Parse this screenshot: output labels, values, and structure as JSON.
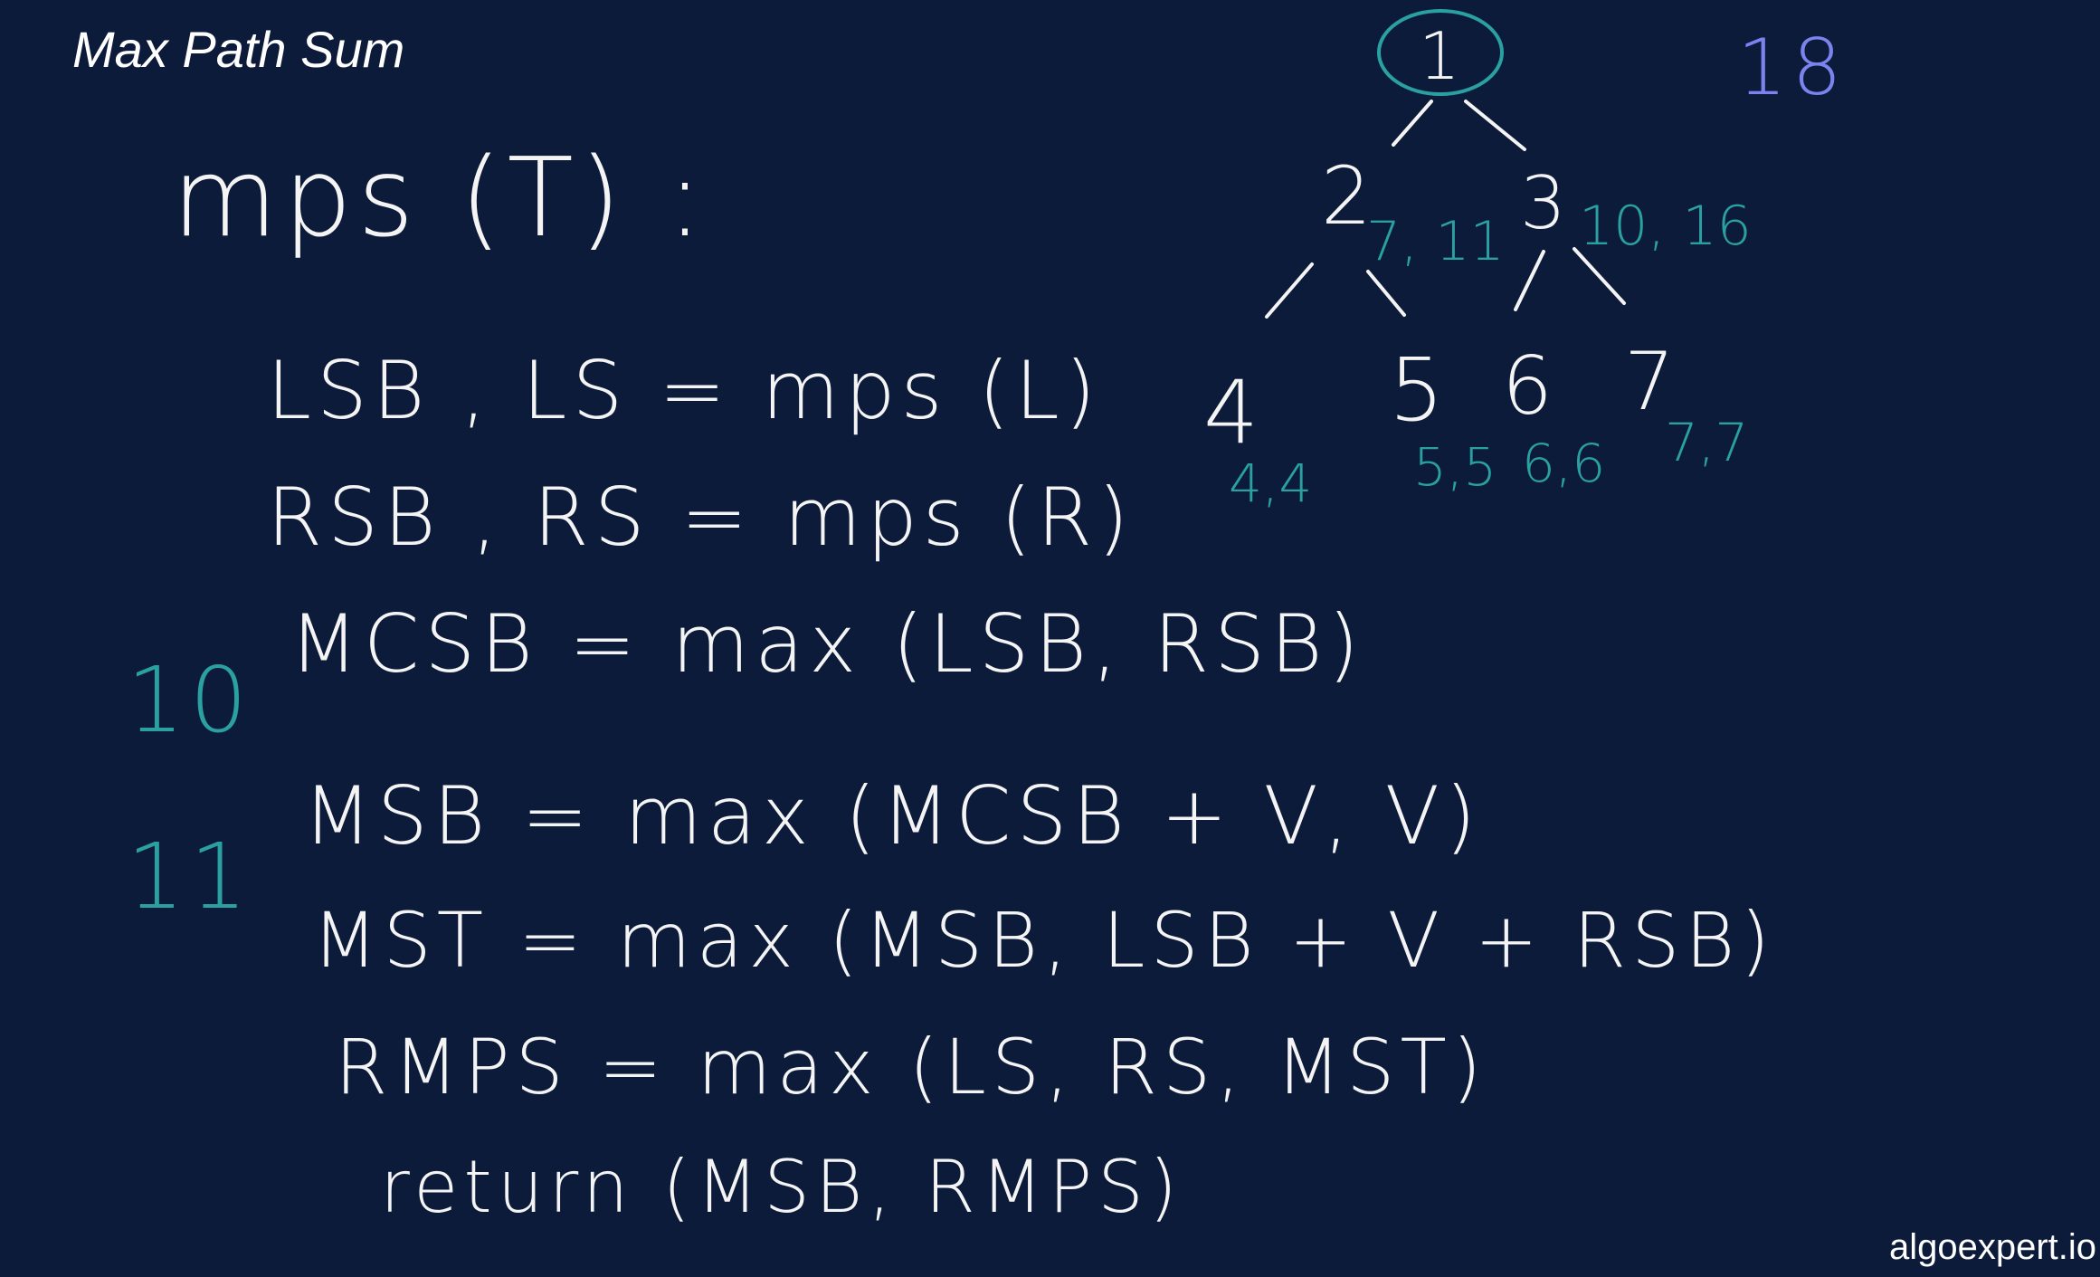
{
  "title": "Max Path Sum",
  "watermark": "algoexpert.io",
  "colors": {
    "background": "#0d1b3a",
    "chalk": "#f4f4f4",
    "teal": "#2aa1a0",
    "blue": "#7a83ee"
  },
  "algorithm": {
    "header": "mps (T) :",
    "line1": "LSB , LS = mps (L)",
    "line2": "RSB , RS = mps (R)",
    "line3": "MCSB = max (LSB, RSB)",
    "line4": "MSB = max (MCSB + V, V)",
    "line5": "MST = max (MSB, LSB + V + RSB)",
    "line6": "RMPS = max (LS, RS, MST)",
    "line7": "return (MSB, RMPS)",
    "note_mcsb": "10",
    "note_msb": "11"
  },
  "tree": {
    "nodes": [
      "1",
      "2",
      "3",
      "4",
      "5",
      "6",
      "7"
    ],
    "annotations": {
      "n2": "7, 11",
      "n3": "10, 16",
      "n4": "4,4",
      "n5": "5,5",
      "n6": "6,6",
      "n7": "7,7"
    },
    "result": "18"
  }
}
